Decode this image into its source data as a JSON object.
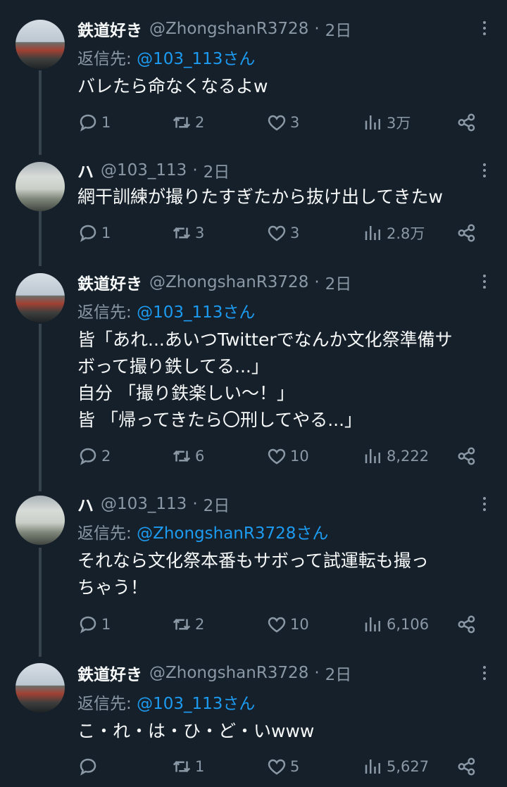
{
  "tweets": [
    {
      "name": "鉄道好き",
      "handle": "@ZhongshanR3728",
      "sep": "·",
      "time": "2日",
      "reply_prefix": "返信先: ",
      "reply_to": "@103_113さん",
      "lines": [
        "バレたら命なくなるよw"
      ],
      "replies": "1",
      "retweets": "2",
      "likes": "3",
      "views": "3万",
      "avatar": "train-photo-red"
    },
    {
      "name": "ハ",
      "handle": "@103_113",
      "sep": "·",
      "time": "2日",
      "reply_prefix": "",
      "reply_to": "",
      "lines": [
        "網干訓練が撮りたすぎたから抜け出してきたw"
      ],
      "replies": "1",
      "retweets": "3",
      "likes": "3",
      "views": "2.8万",
      "avatar": "train-photo-silver"
    },
    {
      "name": "鉄道好き",
      "handle": "@ZhongshanR3728",
      "sep": "·",
      "time": "2日",
      "reply_prefix": "返信先: ",
      "reply_to": "@103_113さん",
      "lines": [
        "皆「あれ...あいつTwitterでなんか文化祭準備サ",
        "ボって撮り鉄してる...」",
        "自分 「撮り鉄楽しい〜！」",
        "皆 「帰ってきたら〇刑してやる...」"
      ],
      "replies": "2",
      "retweets": "6",
      "likes": "10",
      "views": "8,222",
      "avatar": "train-photo-red"
    },
    {
      "name": "ハ",
      "handle": "@103_113",
      "sep": "·",
      "time": "2日",
      "reply_prefix": "返信先: ",
      "reply_to": "@ZhongshanR3728さん",
      "lines": [
        "それなら文化祭本番もサボって試運転も撮っ",
        "ちゃう！"
      ],
      "replies": "1",
      "retweets": "2",
      "likes": "10",
      "views": "6,106",
      "avatar": "train-photo-silver"
    },
    {
      "name": "鉄道好き",
      "handle": "@ZhongshanR3728",
      "sep": "·",
      "time": "2日",
      "reply_prefix": "返信先: ",
      "reply_to": "@103_113さん",
      "lines": [
        "こ・れ・は・ひ・ど・いwww"
      ],
      "replies": "",
      "retweets": "1",
      "likes": "5",
      "views": "5,627",
      "avatar": "train-photo-red"
    }
  ],
  "icons": {
    "reply": "reply-icon",
    "retweet": "retweet-icon",
    "like": "heart-icon",
    "views": "views-icon",
    "share": "share-icon",
    "more": "more-icon"
  },
  "colors": {
    "background": "#15202b",
    "text": "#f7f9f9",
    "secondary": "#8b98a5",
    "link": "#1d9bf0",
    "thread_line": "#38444d"
  }
}
